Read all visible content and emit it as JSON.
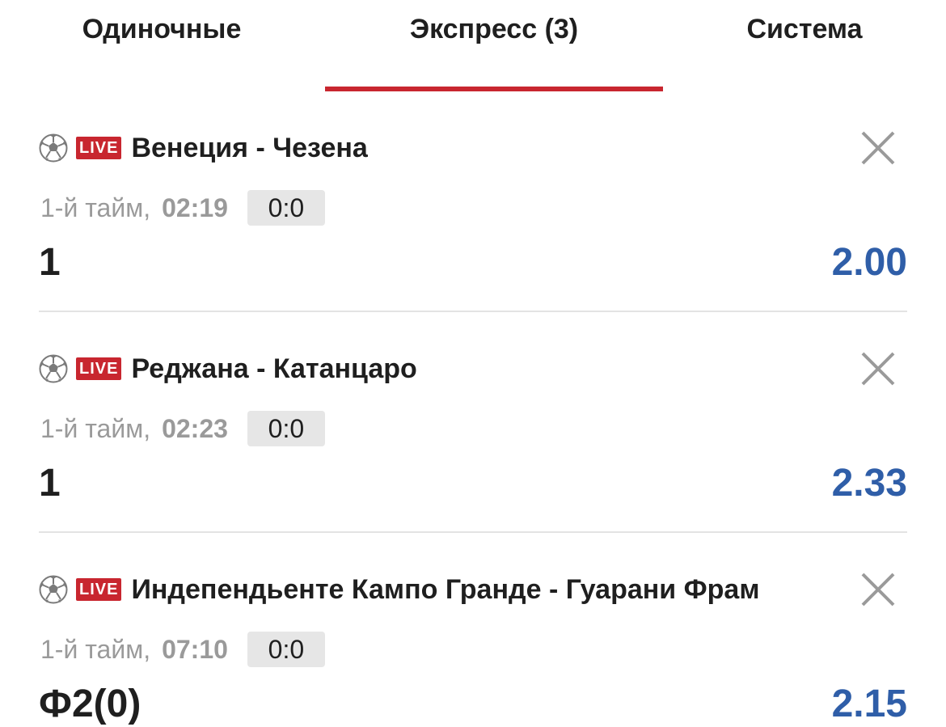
{
  "tabs": [
    {
      "label": "Одиночные"
    },
    {
      "label": "Экспресс (3)"
    },
    {
      "label": "Система"
    }
  ],
  "active_tab": "Экспресс (3)",
  "colors": {
    "accent": "#c8262f",
    "odds": "#2f5ea8",
    "muted": "#9a9a9a"
  },
  "bets": [
    {
      "sport_icon": "soccer-ball-icon",
      "live_label": "LIVE",
      "match": "Венеция - Чезена",
      "period": "1-й тайм,",
      "time": "02:19",
      "score": "0:0",
      "outcome": "1",
      "odds": "2.00"
    },
    {
      "sport_icon": "soccer-ball-icon",
      "live_label": "LIVE",
      "match": "Реджана - Катанцаро",
      "period": "1-й тайм,",
      "time": "02:23",
      "score": "0:0",
      "outcome": "1",
      "odds": "2.33"
    },
    {
      "sport_icon": "soccer-ball-icon",
      "live_label": "LIVE",
      "match": "Индепендьенте Кампо Гранде - Гуарани Фрам",
      "period": "1-й тайм,",
      "time": "07:10",
      "score": "0:0",
      "outcome": "Ф2(0)",
      "odds": "2.15"
    }
  ]
}
